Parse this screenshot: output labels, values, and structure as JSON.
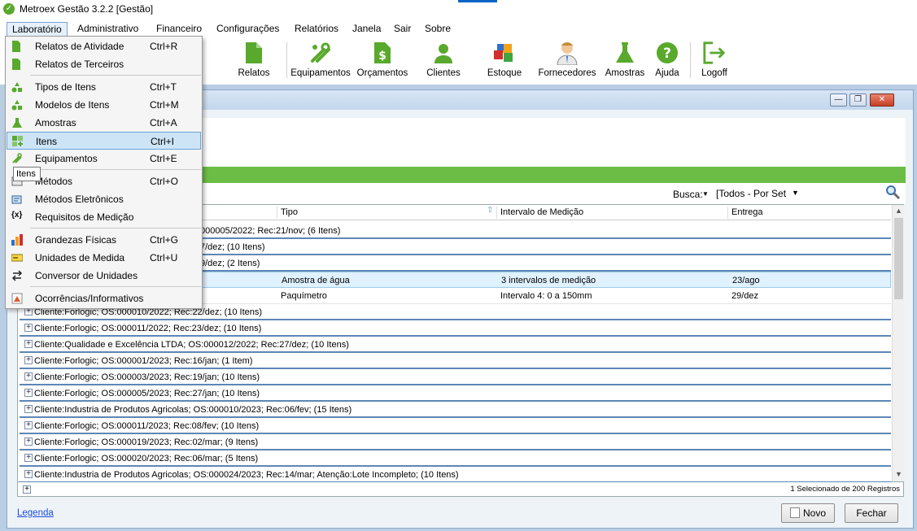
{
  "window": {
    "title": "Metroex Gestão 3.2.2 [Gestão]"
  },
  "menubar": {
    "items": [
      "Laboratório",
      "Administrativo",
      "Financeiro",
      "Configurações",
      "Relatórios",
      "Janela",
      "Sair",
      "Sobre"
    ]
  },
  "toolbar": {
    "buttons": [
      "Relatos",
      "Equipamentos",
      "Orçamentos",
      "Clientes",
      "Estoque",
      "Fornecedores",
      "Amostras",
      "Ajuda",
      "Logoff"
    ]
  },
  "child_window": {
    "controls": {
      "minimize": "—",
      "restore": "❐",
      "close": "✕"
    }
  },
  "search": {
    "label": "Busca:",
    "selected": "[Todos - Por Set"
  },
  "grid": {
    "columns": [
      "Tipo",
      "Intervalo de Medição",
      "Entrega"
    ],
    "rows": [
      {
        "text": "000005/2022;   Rec:21/nov;    (6 Itens)"
      },
      {
        "text": "7/dez;    (10 Itens)"
      },
      {
        "text": "9/dez;    (2 Itens)"
      },
      {
        "tipo": "Amostra de água",
        "intervalo": "3 intervalos de medição",
        "entrega": "23/ago"
      },
      {
        "tipo": "Paquímetro",
        "intervalo": "Intervalo 4: 0 a 150mm",
        "entrega": "29/dez"
      },
      {
        "text": "Cliente:Forlogic;    OS:000010/2022;    Rec:22/dez;    (10 Itens)"
      },
      {
        "text": "Cliente:Forlogic;    OS:000011/2022;    Rec:23/dez;    (10 Itens)"
      },
      {
        "text": "Cliente:Qualidade e Excelência LTDA;    OS:000012/2022;    Rec:27/dez;    (10 Itens)"
      },
      {
        "text": "Cliente:Forlogic;    OS:000001/2023;    Rec:16/jan;    (1 Item)"
      },
      {
        "text": "Cliente:Forlogic;    OS:000003/2023;    Rec:19/jan;    (10 Itens)"
      },
      {
        "text": "Cliente:Forlogic;    OS:000005/2023;    Rec:27/jan;    (10 Itens)"
      },
      {
        "text": "Cliente:Industria de Produtos Agricolas;    OS:000010/2023;    Rec:06/fev;    (15 Itens)"
      },
      {
        "text": "Cliente:Forlogic;    OS:000011/2023;    Rec:08/fev;    (10 Itens)"
      },
      {
        "text": "Cliente:Forlogic;    OS:000019/2023;    Rec:02/mar;    (9 Itens)"
      },
      {
        "text": "Cliente:Forlogic;    OS:000020/2023;    Rec:06/mar;    (5 Itens)"
      },
      {
        "text": "Cliente:Industria de Produtos Agricolas;    OS:000024/2023;    Rec:14/mar;    Atenção:Lote Incompleto;    (10 Itens)"
      }
    ]
  },
  "footer": {
    "status": "1 Selecionado de 200 Registros",
    "legend_link": "Legenda",
    "new_button": "Novo",
    "close_button": "Fechar"
  },
  "dropdown": {
    "items": [
      {
        "label": "Relatos de Atividade",
        "shortcut": "Ctrl+R"
      },
      {
        "label": "Relatos de Terceiros",
        "shortcut": ""
      },
      {
        "label": "Tipos de Itens",
        "shortcut": "Ctrl+T"
      },
      {
        "label": "Modelos de Itens",
        "shortcut": "Ctrl+M"
      },
      {
        "label": "Amostras",
        "shortcut": "Ctrl+A"
      },
      {
        "label": "Itens",
        "shortcut": "Ctrl+I"
      },
      {
        "label": "Equipamentos",
        "shortcut": "Ctrl+E"
      },
      {
        "label": "Métodos",
        "shortcut": "Ctrl+O"
      },
      {
        "label": "Métodos Eletrônicos",
        "shortcut": ""
      },
      {
        "label": "Requisitos de Medição",
        "shortcut": ""
      },
      {
        "label": "Grandezas Físicas",
        "shortcut": "Ctrl+G"
      },
      {
        "label": "Unidades de Medida",
        "shortcut": "Ctrl+U"
      },
      {
        "label": "Conversor de Unidades",
        "shortcut": ""
      },
      {
        "label": "Ocorrências/Informativos",
        "shortcut": ""
      }
    ],
    "tooltip": "Itens"
  },
  "colors": {
    "brand_green": "#59a92c",
    "header_green": "#6cbd45",
    "selection": "#cde4f7"
  }
}
